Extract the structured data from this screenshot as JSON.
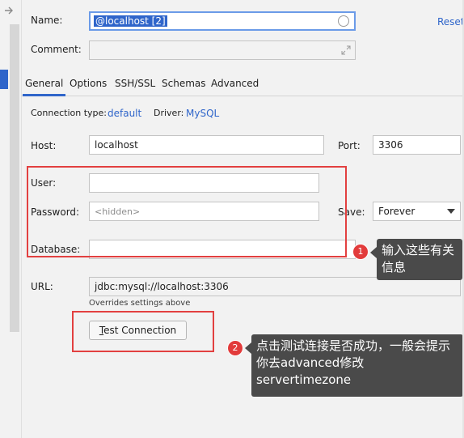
{
  "header": {
    "name_label": "Name:",
    "name_value": "@localhost [2]",
    "reset_label": "Reset",
    "comment_label": "Comment:",
    "comment_value": ""
  },
  "tabs": [
    {
      "label": "General",
      "active": true
    },
    {
      "label": "Options",
      "active": false
    },
    {
      "label": "SSH/SSL",
      "active": false
    },
    {
      "label": "Schemas",
      "active": false
    },
    {
      "label": "Advanced",
      "active": false
    }
  ],
  "connection": {
    "type_label": "Connection type:",
    "type_value": "default",
    "driver_label": "Driver:",
    "driver_value": "MySQL"
  },
  "host": {
    "label": "Host:",
    "value": "localhost"
  },
  "port": {
    "label": "Port:",
    "value": "3306"
  },
  "user": {
    "label": "User:",
    "value": ""
  },
  "password": {
    "label": "Password:",
    "placeholder": "<hidden>"
  },
  "save": {
    "label": "Save:",
    "value": "Forever"
  },
  "database": {
    "label": "Database:",
    "value": ""
  },
  "url": {
    "label": "URL:",
    "value": "jdbc:mysql://localhost:3306",
    "hint": "Overrides settings above"
  },
  "test_button": {
    "mnemonic": "T",
    "rest": "est Connection"
  },
  "annotations": [
    {
      "number": "1",
      "text": "输入这些有关信息"
    },
    {
      "number": "2",
      "text": "点击测试连接是否成功，一般会提示你去advanced修改servertimezone"
    }
  ],
  "colors": {
    "accent": "#2f65ca",
    "annotation_red": "#e23b3b",
    "tooltip_bg": "#4a4a4a"
  }
}
